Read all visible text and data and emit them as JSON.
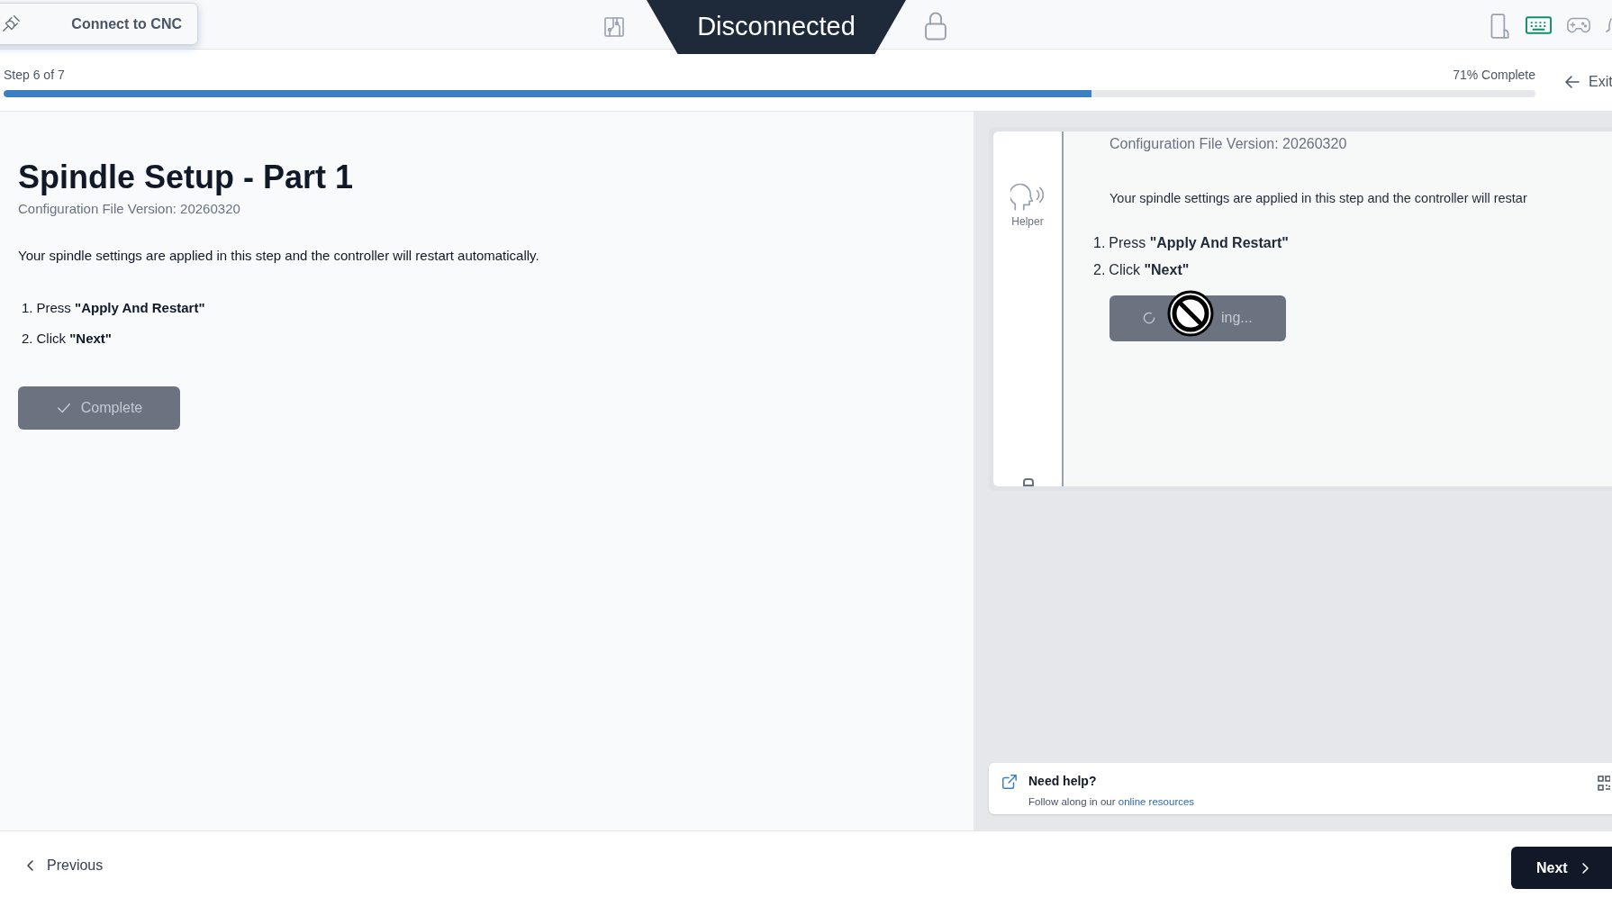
{
  "top_bar": {
    "connect_button": "Connect to CNC",
    "status": "Disconnected"
  },
  "progress": {
    "step": "Step 6 of 7",
    "percent_label": "71% Complete",
    "level": 0.71,
    "exit": "Exit"
  },
  "main": {
    "title": "Spindle Setup - Part 1",
    "subtitle": "Configuration File Version: 20260320",
    "description": "Your spindle settings are applied in this step and the controller will restart automatically.",
    "steps": [
      {
        "number": "1.",
        "text": "Press **\"Apply And Restart\"**"
      },
      {
        "number": "2.",
        "text": "Click **\"Next\"**"
      }
    ],
    "button": {
      "label": "Complete",
      "disabled": true
    }
  },
  "helper": {
    "tab_label": "Helper",
    "subtitle": "Configuration File Version: 20260320",
    "description": "Your spindle settings are applied in this step and the controller will restar",
    "steps": [
      {
        "number": "1.",
        "text": "Press **\"Apply And Restart\"**"
      },
      {
        "number": "2.",
        "text": "Click **\"Next\"**"
      }
    ],
    "button": {
      "label": "ing...",
      "disabled": true
    }
  },
  "help_card": {
    "title": "Need help?",
    "text": "Follow along in our",
    "link": "online resources"
  },
  "footer": {
    "previous": "Previous",
    "next": "Next"
  }
}
